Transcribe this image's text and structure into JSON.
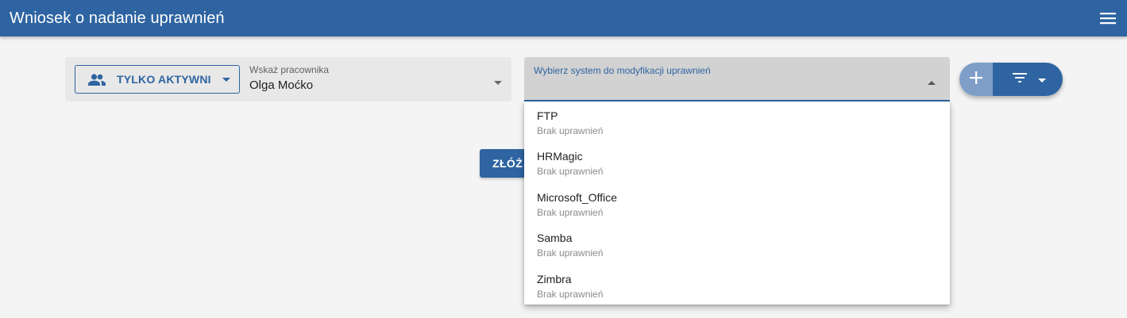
{
  "appbar": {
    "title": "Wniosek o nadanie uprawnień",
    "menu_icon": "hamburger-menu-icon",
    "color": "#2e64a1"
  },
  "filter": {
    "active_button_label": "TYLKO AKTYWNI",
    "active_button_icon": "people-icon",
    "employee_label": "Wskaż pracownika",
    "employee_value": "Olga Moćko"
  },
  "system_select": {
    "label": "Wybierz system do modyfikacji uprawnień",
    "options": [
      {
        "name": "FTP",
        "status": "Brak uprawnień"
      },
      {
        "name": "HRMagic",
        "status": "Brak uprawnień"
      },
      {
        "name": "Microsoft_Office",
        "status": "Brak uprawnień"
      },
      {
        "name": "Samba",
        "status": "Brak uprawnień"
      },
      {
        "name": "Zimbra",
        "status": "Brak uprawnień"
      }
    ]
  },
  "actions": {
    "add_icon": "plus-icon",
    "filter_icon": "filter-list-icon",
    "submit_label": "ZŁÓŻ W"
  }
}
